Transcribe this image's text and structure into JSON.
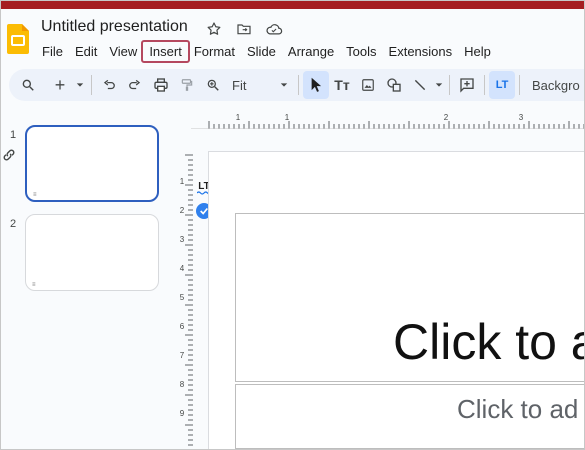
{
  "window": {
    "accent_bar_color": "#a51d21"
  },
  "header": {
    "title": "Untitled presentation",
    "icons": [
      "star-icon",
      "move-to-folder-icon",
      "cloud-status-icon"
    ]
  },
  "menu": {
    "items": [
      {
        "label": "File",
        "name": "menu-file"
      },
      {
        "label": "Edit",
        "name": "menu-edit"
      },
      {
        "label": "View",
        "name": "menu-view"
      },
      {
        "label": "Insert",
        "name": "menu-insert",
        "highlighted": true
      },
      {
        "label": "Format",
        "name": "menu-format"
      },
      {
        "label": "Slide",
        "name": "menu-slide"
      },
      {
        "label": "Arrange",
        "name": "menu-arrange"
      },
      {
        "label": "Tools",
        "name": "menu-tools"
      },
      {
        "label": "Extensions",
        "name": "menu-extensions"
      },
      {
        "label": "Help",
        "name": "menu-help"
      }
    ],
    "highlight_color": "#b5485f"
  },
  "toolbar": {
    "zoom_value": "Fit",
    "background_label": "Backgro",
    "plus_label": "+",
    "text_tool_label": "Tт"
  },
  "filmstrip": {
    "slides": [
      {
        "number": "1",
        "selected": true
      },
      {
        "number": "2",
        "selected": false
      }
    ]
  },
  "ruler": {
    "h_labels": [
      "1",
      "1",
      "2",
      "3"
    ],
    "v_labels": [
      "1",
      "2",
      "3",
      "4",
      "5",
      "6",
      "7",
      "8",
      "9"
    ]
  },
  "canvas": {
    "title_placeholder": "Click to a",
    "subtitle_placeholder": "Click to ad"
  },
  "languagetool": {
    "badge": "LT"
  }
}
